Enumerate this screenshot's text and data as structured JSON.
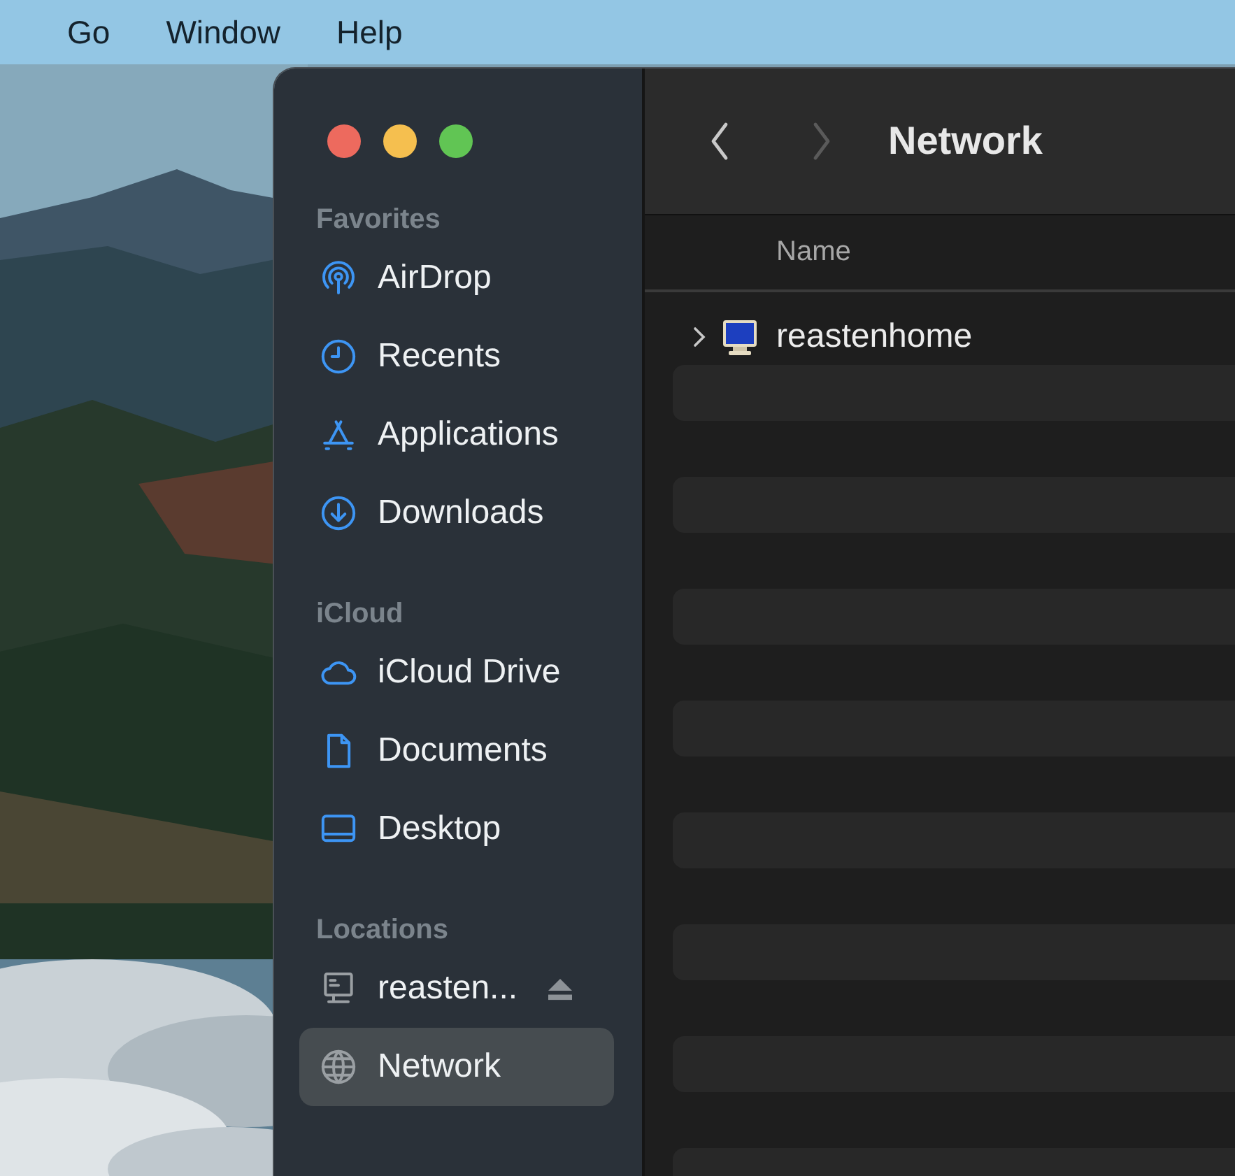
{
  "menu_bar": {
    "items": [
      "Go",
      "Window",
      "Help"
    ]
  },
  "sidebar": {
    "sections": [
      {
        "title": "Favorites",
        "items": [
          {
            "label": "AirDrop",
            "selected": false
          },
          {
            "label": "Recents",
            "selected": false
          },
          {
            "label": "Applications",
            "selected": false
          },
          {
            "label": "Downloads",
            "selected": false
          }
        ]
      },
      {
        "title": "iCloud",
        "items": [
          {
            "label": "iCloud Drive",
            "selected": false
          },
          {
            "label": "Documents",
            "selected": false
          },
          {
            "label": "Desktop",
            "selected": false
          }
        ]
      },
      {
        "title": "Locations",
        "items": [
          {
            "label": "reasten...",
            "selected": false,
            "ejectable": true
          },
          {
            "label": "Network",
            "selected": true,
            "ejectable": false
          }
        ]
      }
    ]
  },
  "toolbar": {
    "back_disabled": false,
    "forward_disabled": true,
    "title": "Network"
  },
  "list": {
    "columns": [
      "Name"
    ],
    "rows": [
      {
        "name": "reastenhome",
        "expanded": false
      }
    ]
  }
}
